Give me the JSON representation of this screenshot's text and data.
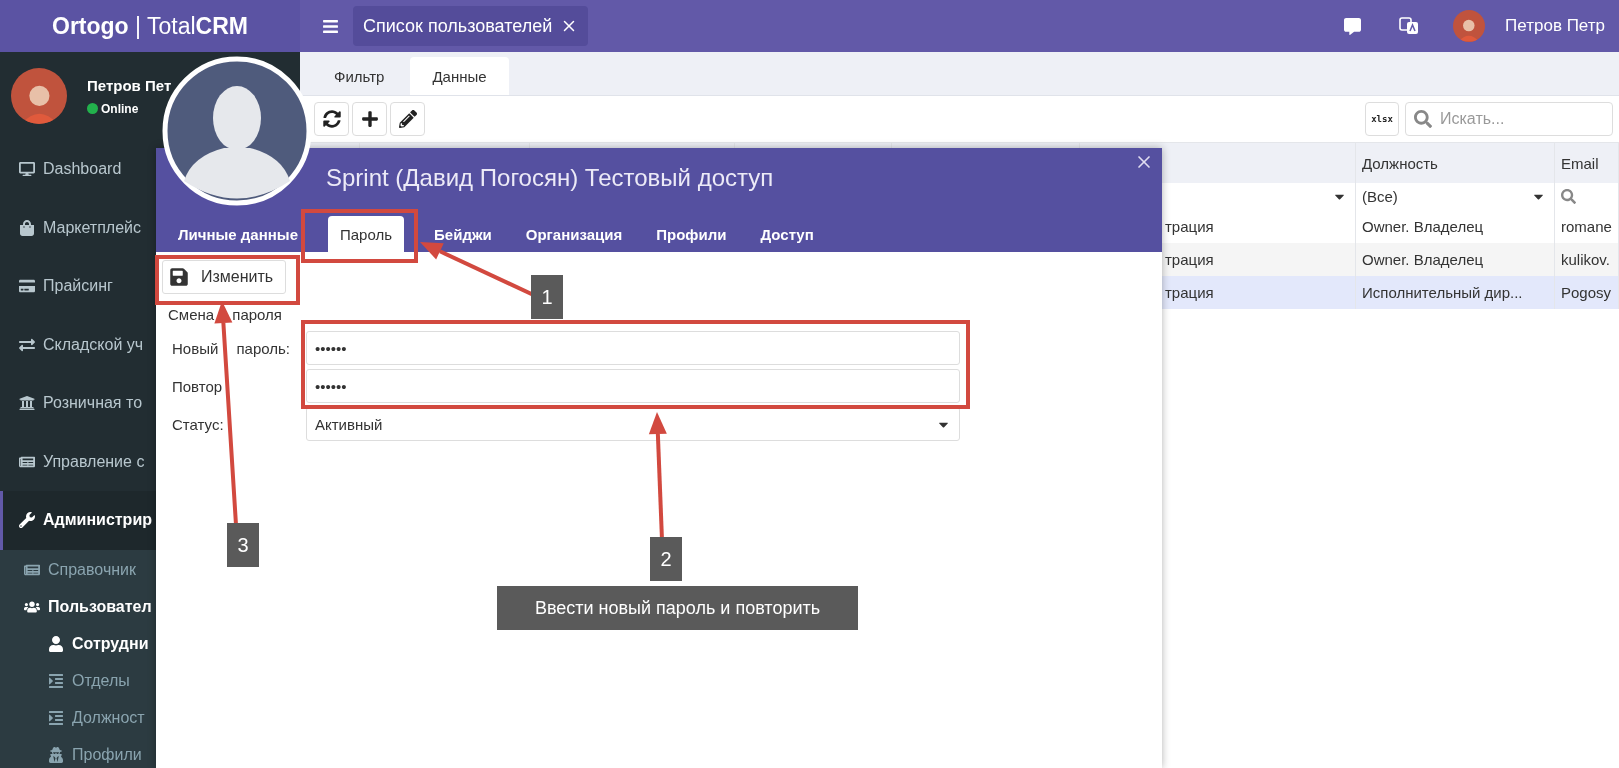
{
  "app_bar": {
    "brand": "**Ortogo** | Total**CRM**",
    "open_tab": "Список пользователей",
    "user_name": "Петров Петр"
  },
  "sidebar": {
    "user": {
      "name": "Петров Пет",
      "status": "Online",
      "online": true
    },
    "items": [
      {
        "label": "Dashboard",
        "selected": false
      },
      {
        "label": "Маркетплейс",
        "selected": false
      },
      {
        "label": "Прайсинг",
        "selected": false
      },
      {
        "label": "Складской уч",
        "selected": false
      },
      {
        "label": "Розничная то",
        "selected": false
      },
      {
        "label": "Управление с",
        "selected": false
      },
      {
        "label": "Администрир",
        "selected": true,
        "children": [
          {
            "label": "Справочник",
            "selected": false
          },
          {
            "label": "Пользовател",
            "selected": true,
            "children": [
              {
                "label": "Сотрудни",
                "selected": true
              },
              {
                "label": "Отделы",
                "selected": false
              },
              {
                "label": "Должност",
                "selected": false
              },
              {
                "label": "Профили",
                "selected": false
              }
            ]
          }
        ]
      }
    ]
  },
  "main": {
    "tabs": [
      {
        "label": "Фильтр",
        "selected": false
      },
      {
        "label": "Данные",
        "selected": true
      }
    ],
    "export_label": "xlsx",
    "search": {
      "placeholder": "Искать..."
    },
    "table": {
      "columns": [
        "",
        "Должность",
        "Email"
      ],
      "filters": [
        {
          "kind": "dropdown"
        },
        {
          "kind": "dropdown",
          "value": "(Все)"
        },
        {
          "kind": "search"
        }
      ],
      "rows": [
        {
          "cells": [
            "трация",
            "Owner. Владелец",
            "romane"
          ],
          "selected": false
        },
        {
          "cells": [
            "трация",
            "Owner. Владелец",
            "kulikov."
          ],
          "selected": false
        },
        {
          "cells": [
            "трация",
            "Исполнительный дир...",
            "Pogosy"
          ],
          "selected": true
        }
      ]
    }
  },
  "dialog": {
    "title": "Sprint (Давид Погосян) Тестовый доступ",
    "tabs": [
      {
        "label": "Личные данные",
        "selected": false
      },
      {
        "label": "Пароль",
        "selected": true
      },
      {
        "label": "Бейджи",
        "selected": false
      },
      {
        "label": "Организация",
        "selected": false
      },
      {
        "label": "Профили",
        "selected": false
      },
      {
        "label": "Доступ",
        "selected": false
      }
    ],
    "save_button": "Изменить",
    "section_title": "Смена пароля",
    "fields": [
      {
        "label": "Новый пароль:",
        "kind": "password",
        "value": "••••••"
      },
      {
        "label": "Повтор",
        "kind": "password",
        "value": "••••••"
      },
      {
        "label": "Статус:",
        "kind": "select",
        "value": "Активный"
      }
    ]
  },
  "annotations": {
    "markers": [
      "1",
      "2",
      "3"
    ],
    "callout": "Ввести новый пароль и повторить"
  }
}
